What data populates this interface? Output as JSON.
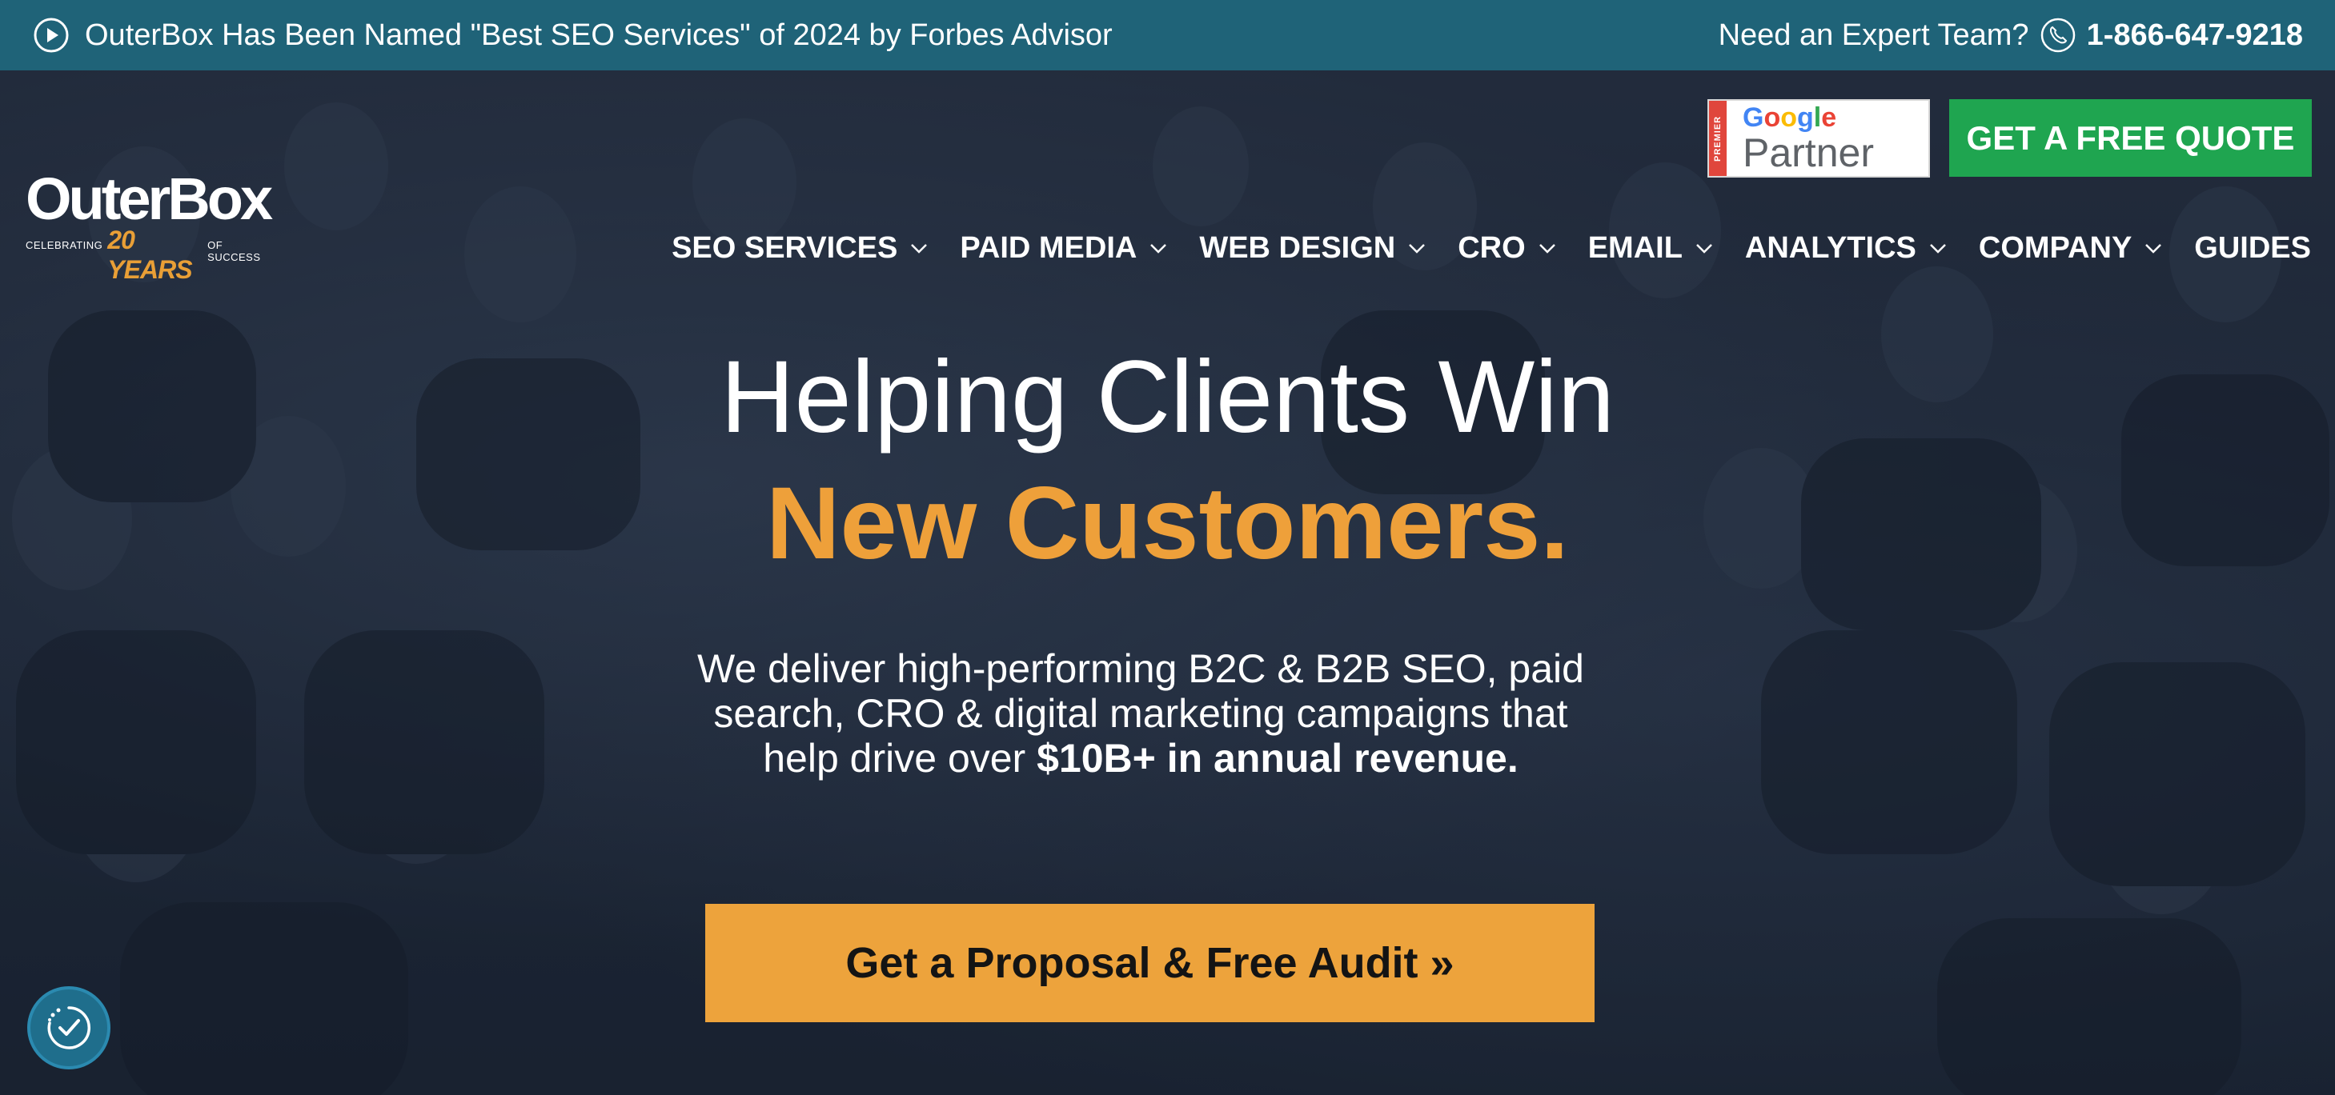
{
  "topbar": {
    "announcement": "OuterBox Has Been Named \"Best SEO Services\" of 2024 by Forbes Advisor",
    "announcement_icon": "play-circle-icon",
    "expert_label": "Need an Expert Team?",
    "phone_icon": "phone-icon",
    "phone": "1-866-647-9218",
    "background": "#1f6378"
  },
  "header": {
    "logo": {
      "brand": "OuterBox",
      "tagline_prefix": "CELEBRATING",
      "tagline_years": "20 YEARS",
      "tagline_suffix": "OF SUCCESS"
    },
    "partner_badge": {
      "premier": "PREMIER",
      "google": "Google",
      "partner": "Partner"
    },
    "quote_button": "GET A FREE QUOTE",
    "quote_color": "#1fa550",
    "nav": [
      {
        "label": "SEO SERVICES",
        "dropdown": true
      },
      {
        "label": "PAID MEDIA",
        "dropdown": true
      },
      {
        "label": "WEB DESIGN",
        "dropdown": true
      },
      {
        "label": "CRO",
        "dropdown": true
      },
      {
        "label": "EMAIL",
        "dropdown": true
      },
      {
        "label": "ANALYTICS",
        "dropdown": true
      },
      {
        "label": "COMPANY",
        "dropdown": true
      },
      {
        "label": "GUIDES",
        "dropdown": false
      }
    ]
  },
  "hero": {
    "headline_line1": "Helping Clients Win",
    "headline_line2": "New Customers.",
    "accent": "#eea03a",
    "subtext_plain": "We deliver high-performing B2C & B2B SEO, paid search, CRO & digital marketing campaigns that help drive over ",
    "subtext_bold": "$10B+ in annual revenue.",
    "cta": "Get a Proposal & Free Audit »",
    "cta_color": "#eda33c"
  },
  "accessibility_button": {
    "icon": "accessibility-icon"
  }
}
